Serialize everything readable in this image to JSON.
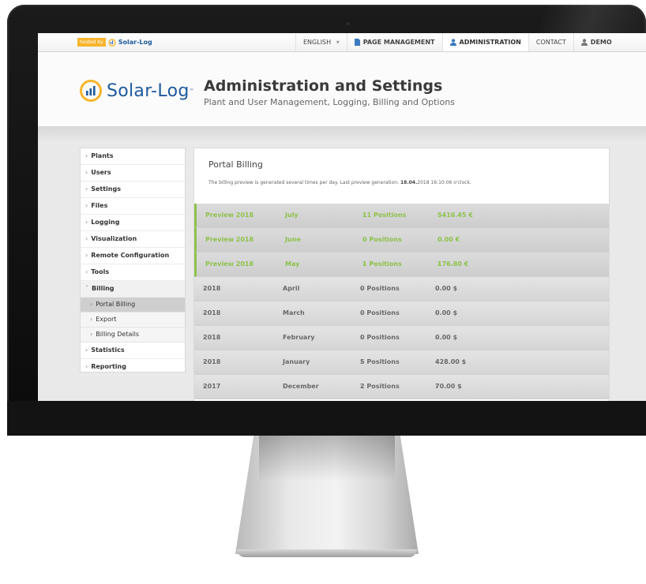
{
  "topnav": {
    "hosted_tag": "hosted by",
    "hosted_brand": "Solar-Log",
    "items": [
      {
        "label": "ENGLISH",
        "suffix": "▾"
      },
      {
        "label": "PAGE MANAGEMENT"
      },
      {
        "label": "ADMINISTRATION"
      },
      {
        "label": "CONTACT"
      },
      {
        "label": "DEMO"
      }
    ]
  },
  "header": {
    "logo_text": "Solar-Log",
    "logo_tm": "™",
    "title": "Administration and Settings",
    "subtitle": "Plant and User Management, Logging, Billing and Options"
  },
  "sidebar": {
    "items": [
      {
        "label": "Plants"
      },
      {
        "label": "Users"
      },
      {
        "label": "Settings"
      },
      {
        "label": "Files"
      },
      {
        "label": "Logging"
      },
      {
        "label": "Visualization"
      },
      {
        "label": "Remote Configuration"
      },
      {
        "label": "Tools"
      },
      {
        "label": "Billing"
      },
      {
        "label": "Statistics"
      },
      {
        "label": "Reporting"
      }
    ],
    "billing_sub": [
      {
        "label": "Portal Billing"
      },
      {
        "label": "Export"
      },
      {
        "label": "Billing Details"
      }
    ]
  },
  "main": {
    "title": "Portal Billing",
    "note_prefix": "The billing preview is generated several times per day. Last preview generation: ",
    "note_date": "18.04.",
    "note_suffix": "2018 16:10:06 o'clock.",
    "rows": [
      {
        "year": "Preview 2018",
        "month": "July",
        "positions": "11 Positions",
        "amount": "5416.45 €",
        "preview": true
      },
      {
        "year": "Preview 2018",
        "month": "June",
        "positions": "0 Positions",
        "amount": "0.00 €",
        "preview": true
      },
      {
        "year": "Preview 2018",
        "month": "May",
        "positions": "1 Positions",
        "amount": "176.80 €",
        "preview": true
      },
      {
        "year": "2018",
        "month": "April",
        "positions": "0 Positions",
        "amount": "0.00 $",
        "preview": false
      },
      {
        "year": "2018",
        "month": "March",
        "positions": "0 Positions",
        "amount": "0.00 $",
        "preview": false
      },
      {
        "year": "2018",
        "month": "February",
        "positions": "0 Positions",
        "amount": "0.00 $",
        "preview": false
      },
      {
        "year": "2018",
        "month": "January",
        "positions": "5 Positions",
        "amount": "428.00 $",
        "preview": false
      },
      {
        "year": "2017",
        "month": "December",
        "positions": "2 Positions",
        "amount": "70.00 $",
        "preview": false
      }
    ]
  },
  "colors": {
    "brand_blue": "#1d5a9e",
    "preview_green": "#8dc24b",
    "hosted_orange": "#f7b52c"
  }
}
